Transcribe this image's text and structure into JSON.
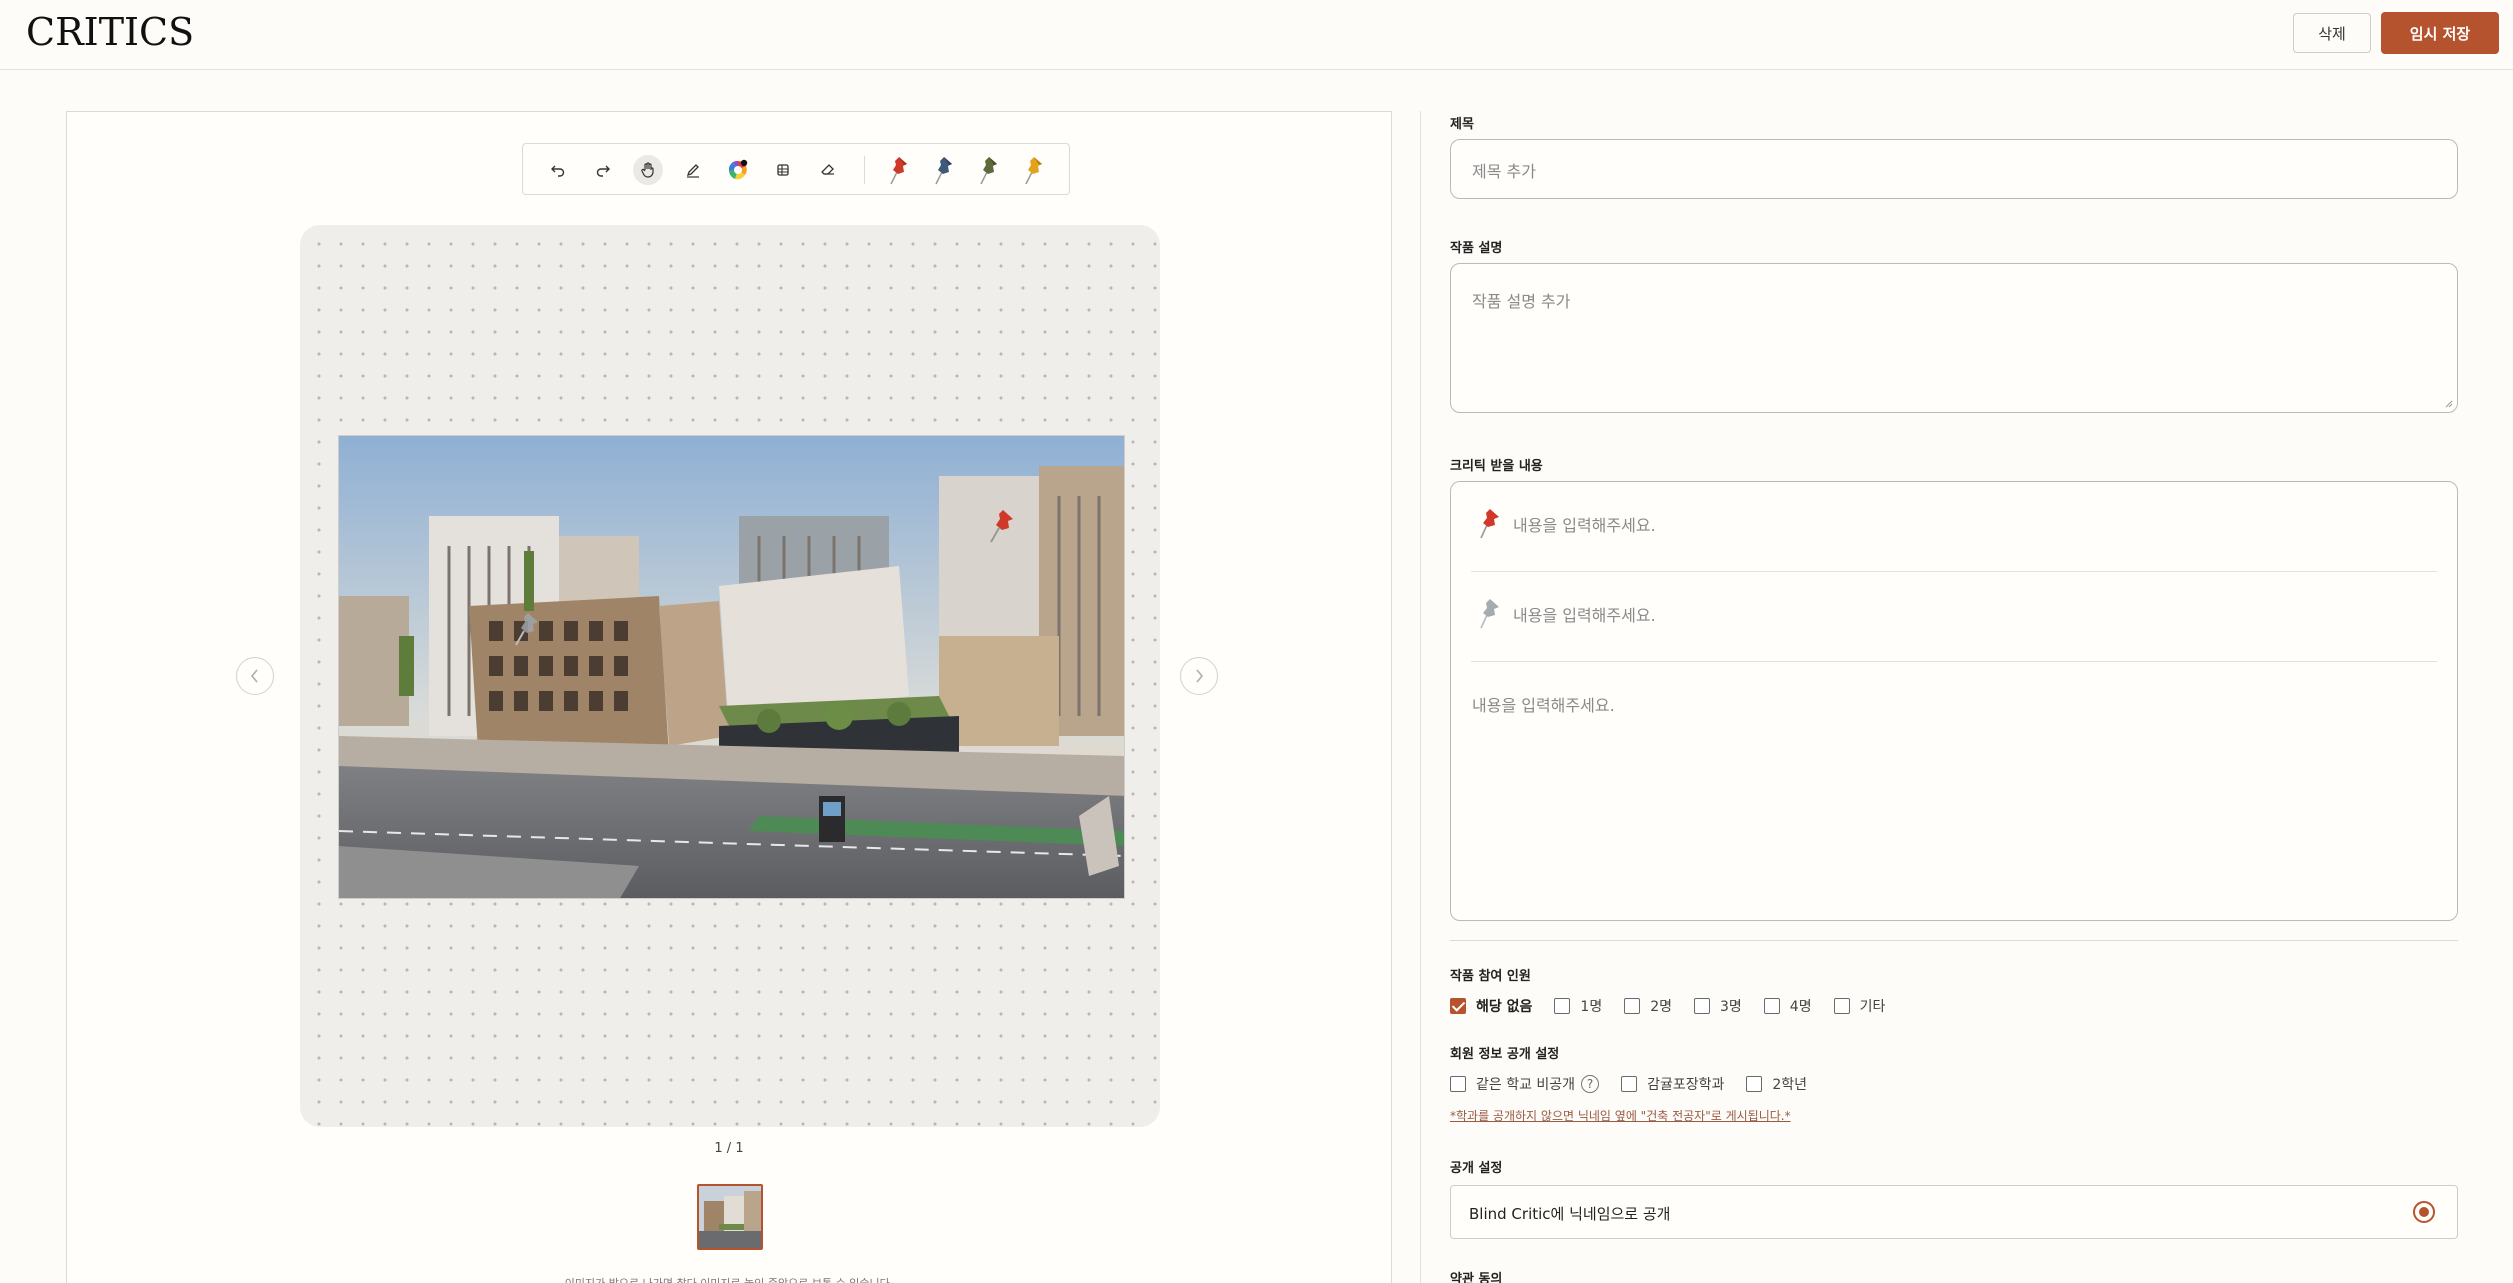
{
  "header": {
    "logo": "CRITICS",
    "delete_label": "삭제",
    "save_label": "임시 저장",
    "accent_color": "#b5532f"
  },
  "toolbar": {
    "tools": [
      "undo-icon",
      "redo-icon",
      "hand-icon",
      "pen-icon",
      "color-wheel-icon",
      "grid-icon",
      "eraser-icon"
    ],
    "active_tool": "hand-icon",
    "pins": [
      {
        "name": "pin-red",
        "color": "#d0392a"
      },
      {
        "name": "pin-blue",
        "color": "#3f5a78"
      },
      {
        "name": "pin-olive",
        "color": "#5f6a3a"
      },
      {
        "name": "pin-yellow",
        "color": "#e2a21c"
      }
    ]
  },
  "viewer": {
    "page_indicator": "1 / 1",
    "bottom_note": "이미지가 밝으로 나가면 찰다 이미지로 놓인 중앙으로 보통 수 있습니다."
  },
  "form": {
    "title_label": "제목",
    "title_placeholder": "제목 추가",
    "desc_label": "작품 설명",
    "desc_placeholder": "작품 설명 추가",
    "critic_label": "크리틱 받을 내용",
    "critic_rows": [
      {
        "pin": "pin-red",
        "placeholder": "내용을 입력해주세요."
      },
      {
        "pin": "pin-gray",
        "placeholder": "내용을 입력해주세요."
      }
    ],
    "critic_free_placeholder": "내용을 입력해주세요.",
    "participants_label": "작품 참여 인원",
    "participants": [
      {
        "label": "해당 없음",
        "checked": true
      },
      {
        "label": "1명",
        "checked": false
      },
      {
        "label": "2명",
        "checked": false
      },
      {
        "label": "3명",
        "checked": false
      },
      {
        "label": "4명",
        "checked": false
      },
      {
        "label": "기타",
        "checked": false
      }
    ],
    "member_info_label": "회원 정보 공개 설정",
    "member_info": [
      {
        "label": "같은 학교 비공개",
        "checked": false,
        "help": "?"
      },
      {
        "label": "감귤포장학과",
        "checked": false
      },
      {
        "label": "2학년",
        "checked": false
      }
    ],
    "member_note": "*학과를 공개하지 않으면 닉네임 옆에 \"건축 전공자\"로 게시됩니다.*",
    "public_label": "공개 설정",
    "public_option": "Blind Critic에 닉네임으로 공개",
    "terms_label": "약관 동의"
  }
}
